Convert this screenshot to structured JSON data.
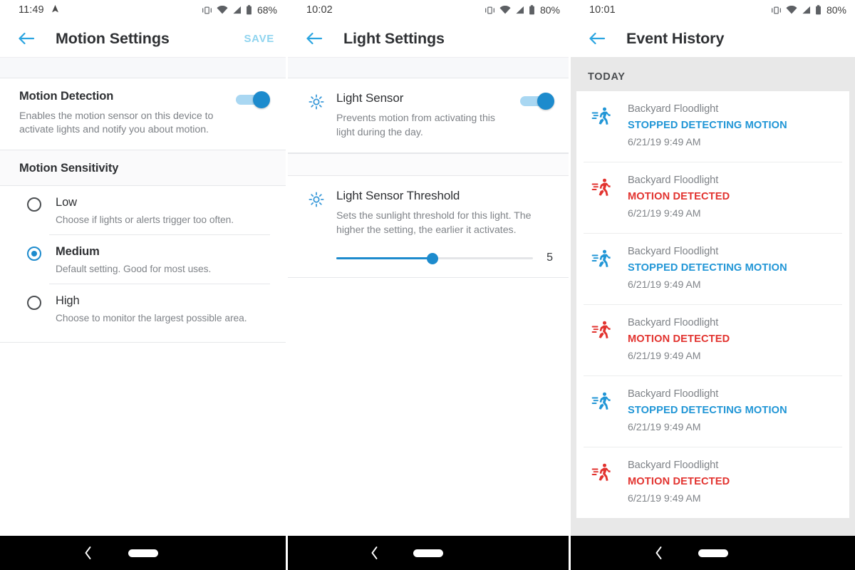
{
  "panels": [
    {
      "status": {
        "time": "11:49",
        "battery": "68%",
        "icons": [
          "location-arrow-icon",
          "vibrate-icon",
          "wifi-icon",
          "signal-icon",
          "battery-icon"
        ]
      },
      "appbar": {
        "title": "Motion Settings",
        "action": "SAVE",
        "back": "back-arrow-icon"
      },
      "motion_detection": {
        "title": "Motion Detection",
        "desc": "Enables the motion sensor on this device to activate lights and notify you about motion.",
        "toggle_on": true
      },
      "sensitivity": {
        "heading": "Motion Sensitivity",
        "options": [
          {
            "label": "Low",
            "desc": "Choose if lights or alerts trigger too often.",
            "selected": false
          },
          {
            "label": "Medium",
            "desc": "Default setting. Good for most uses.",
            "selected": true
          },
          {
            "label": "High",
            "desc": "Choose to monitor the largest possible area.",
            "selected": false
          }
        ]
      }
    },
    {
      "status": {
        "time": "10:02",
        "battery": "80%"
      },
      "appbar": {
        "title": "Light Settings",
        "action": "",
        "back": "back-arrow-icon"
      },
      "light_sensor": {
        "title": "Light Sensor",
        "desc": "Prevents motion from activating this light during the day.",
        "toggle_on": true,
        "icon": "sun-icon"
      },
      "threshold": {
        "title": "Light Sensor Threshold",
        "desc": "Sets the sunlight threshold for this light. The higher the setting, the earlier it activates.",
        "value": "5",
        "percent": 49,
        "icon": "sun-icon"
      }
    },
    {
      "status": {
        "time": "10:01",
        "battery": "80%"
      },
      "appbar": {
        "title": "Event History",
        "action": "",
        "back": "back-arrow-icon"
      },
      "section_header": "TODAY",
      "events": [
        {
          "device": "Backyard Floodlight",
          "status": "STOPPED DETECTING MOTION",
          "time": "6/21/19 9:49 AM",
          "kind": "stopped"
        },
        {
          "device": "Backyard Floodlight",
          "status": "MOTION DETECTED",
          "time": "6/21/19 9:49 AM",
          "kind": "detected"
        },
        {
          "device": "Backyard Floodlight",
          "status": "STOPPED DETECTING MOTION",
          "time": "6/21/19 9:49 AM",
          "kind": "stopped"
        },
        {
          "device": "Backyard Floodlight",
          "status": "MOTION DETECTED",
          "time": "6/21/19 9:49 AM",
          "kind": "detected"
        },
        {
          "device": "Backyard Floodlight",
          "status": "STOPPED DETECTING MOTION",
          "time": "6/21/19 9:49 AM",
          "kind": "stopped"
        },
        {
          "device": "Backyard Floodlight",
          "status": "MOTION DETECTED",
          "time": "6/21/19 9:49 AM",
          "kind": "detected"
        }
      ]
    }
  ],
  "navbar": {
    "back": "nav-back-icon",
    "home": "nav-home-pill"
  },
  "colors": {
    "accent_blue": "#1d8bcd",
    "status_blue": "#2196d6",
    "status_red": "#e2332f",
    "toggle_track": "#a9d7f2",
    "gray_bg": "#e8e8e8",
    "save_disabled": "#8fd4ef"
  }
}
